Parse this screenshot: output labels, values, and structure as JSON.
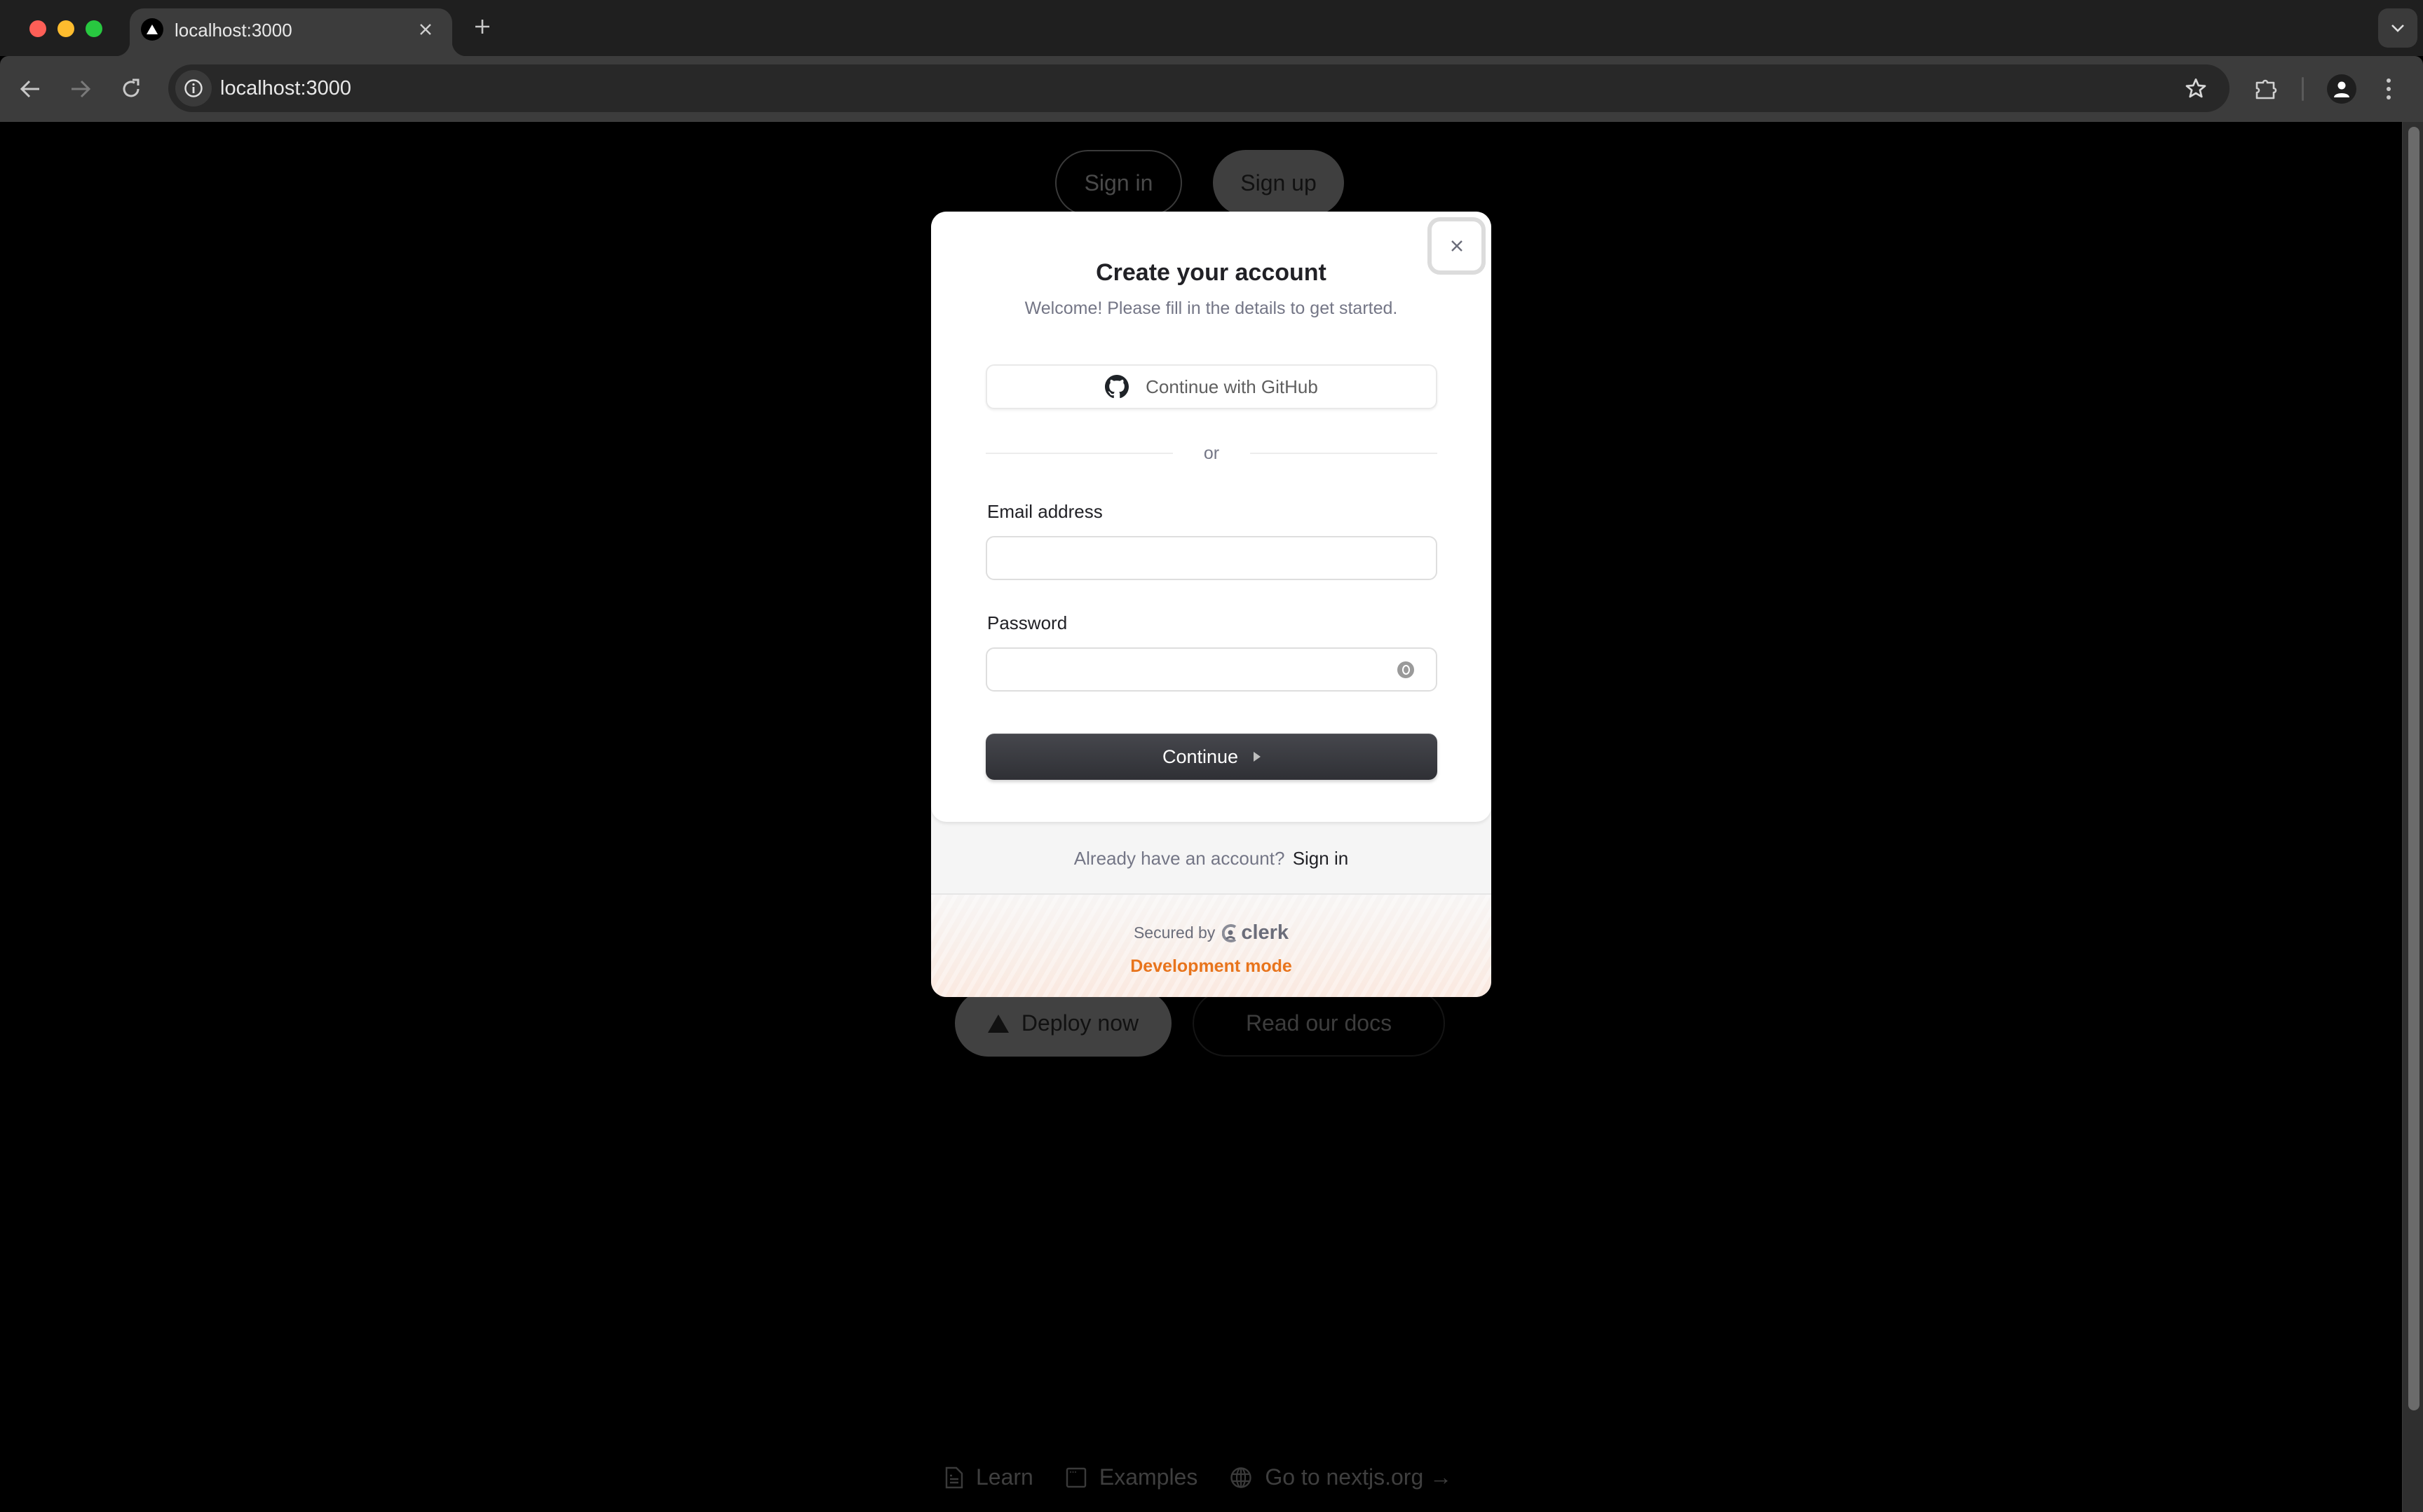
{
  "browser": {
    "tab": {
      "title": "localhost:3000",
      "favicon": "nextjs-triangle-icon"
    },
    "new_tab_label": "+",
    "address": {
      "url": "localhost:3000"
    },
    "icons": {
      "back": "arrow-left-icon",
      "forward": "arrow-right-icon",
      "reload": "reload-icon",
      "site_info": "info-icon",
      "bookmark": "star-icon",
      "extensions": "puzzle-icon",
      "profile": "person-icon",
      "menu": "kebab-menu-icon",
      "tab_list": "chevron-down-icon"
    },
    "scrollbar": {
      "thumb_fraction": 0.93,
      "position": 0
    }
  },
  "page": {
    "auth_buttons": {
      "sign_in": "Sign in",
      "sign_up": "Sign up"
    },
    "cta": {
      "deploy": "Deploy now",
      "docs": "Read our docs"
    },
    "footer_links": [
      {
        "label": "Learn",
        "icon": "file-icon"
      },
      {
        "label": "Examples",
        "icon": "window-icon"
      },
      {
        "label": "Go to nextjs.org →",
        "icon": "globe-icon"
      }
    ]
  },
  "modal": {
    "title": "Create your account",
    "subtitle": "Welcome! Please fill in the details to get started.",
    "close_label": "×",
    "github_button": "Continue with GitHub",
    "divider_text": "or",
    "email": {
      "label": "Email address",
      "value": "",
      "placeholder": ""
    },
    "password": {
      "label": "Password",
      "value": "",
      "placeholder": ""
    },
    "continue_button": "Continue",
    "alt_prompt": "Already have an account?",
    "alt_link": "Sign in",
    "secured_by": "Secured by",
    "brand": "clerk",
    "dev_mode": "Development mode",
    "colors": {
      "primary_button": "#2f3035",
      "dev_mode": "#e8741c"
    }
  }
}
